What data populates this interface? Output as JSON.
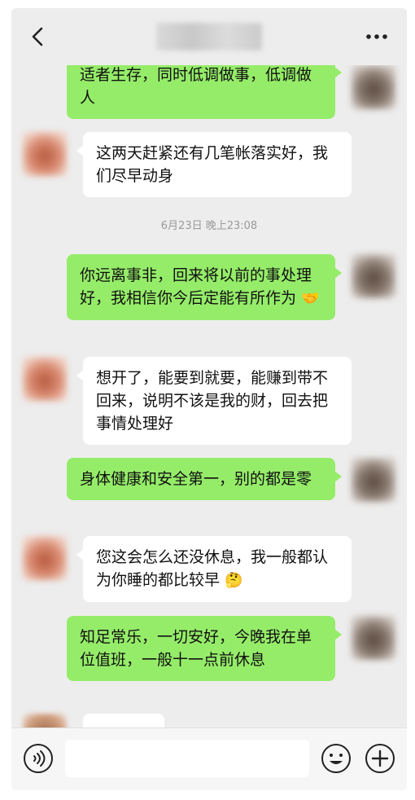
{
  "header": {
    "back_icon": "chevron-left-icon",
    "more_icon": "more-horizontal-icon"
  },
  "messages": [
    {
      "side": "self",
      "text": "适者生存，同时低调做事，低调做人"
    },
    {
      "side": "other",
      "text": "这两天赶紧还有几笔帐落实好，我们尽早动身"
    },
    {
      "side": "self",
      "text": "你远离事非，回来将以前的事处理好，我相信你今后定能有所作为",
      "emoji": "🤝"
    },
    {
      "side": "other",
      "text": "想开了，能要到就要，能赚到带不回来，说明不该是我的财，回去把事情处理好"
    },
    {
      "side": "self",
      "text": "身体健康和安全第一，别的都是零"
    },
    {
      "side": "other",
      "text": "您这会怎么还没休息，我一般都认为你睡的都比较早",
      "emoji": "🤔"
    },
    {
      "side": "self",
      "text": "知足常乐，一切安好，今晚我在单位值班，一般十一点前休息"
    }
  ],
  "timestamp": "6月23日 晚上23:08",
  "input_bar": {
    "voice_icon": "voice-icon",
    "input_value": "",
    "emoji_icon": "emoji-icon",
    "plus_icon": "plus-icon"
  },
  "colors": {
    "self_bubble": "#95ec69",
    "other_bubble": "#ffffff",
    "background": "#ededed"
  }
}
